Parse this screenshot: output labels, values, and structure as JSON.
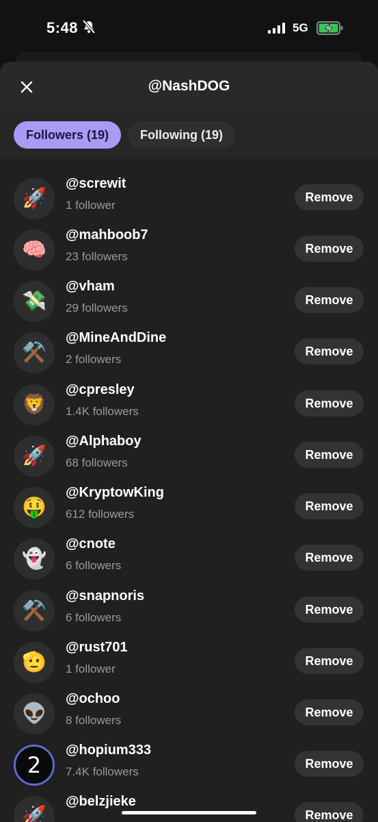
{
  "status_bar": {
    "time": "5:48",
    "network": "5G",
    "bell_icon": "bell-slash-icon",
    "battery_icon": "battery-charging-icon"
  },
  "header": {
    "title": "@NashDOG",
    "close_icon": "close-icon"
  },
  "tabs": [
    {
      "label": "Followers (19)",
      "active": true
    },
    {
      "label": "Following (19)",
      "active": false
    }
  ],
  "accent_color": "#a99bf3",
  "rows": [
    {
      "avatar": "🚀",
      "avatar_icon": "rocket-icon",
      "handle": "@screwit",
      "followers": "1 follower",
      "action": "Remove"
    },
    {
      "avatar": "🧠",
      "avatar_icon": "brain-icon",
      "handle": "@mahboob7",
      "followers": "23 followers",
      "action": "Remove"
    },
    {
      "avatar": "💸",
      "avatar_icon": "money-wings-icon",
      "handle": "@vham",
      "followers": "29 followers",
      "action": "Remove"
    },
    {
      "avatar": "⚒️",
      "avatar_icon": "hammer-pick-icon",
      "handle": "@MineAndDine",
      "followers": "2 followers",
      "action": "Remove"
    },
    {
      "avatar": "🦁",
      "avatar_icon": "lion-icon",
      "handle": "@cpresley",
      "followers": "1.4K followers",
      "action": "Remove"
    },
    {
      "avatar": "🚀",
      "avatar_icon": "rocket-icon",
      "handle": "@Alphaboy",
      "followers": "68 followers",
      "action": "Remove"
    },
    {
      "avatar": "🤑",
      "avatar_icon": "money-mouth-face-icon",
      "handle": "@KryptowKing",
      "followers": "612 followers",
      "action": "Remove"
    },
    {
      "avatar": "👻",
      "avatar_icon": "ghost-icon",
      "handle": "@cnote",
      "followers": "6 followers",
      "action": "Remove"
    },
    {
      "avatar": "⚒️",
      "avatar_icon": "hammer-pick-icon",
      "handle": "@snapnoris",
      "followers": "6 followers",
      "action": "Remove"
    },
    {
      "avatar": "🫡",
      "avatar_icon": "saluting-face-icon",
      "handle": "@rust701",
      "followers": "1 follower",
      "action": "Remove"
    },
    {
      "avatar": "👽",
      "avatar_icon": "alien-icon",
      "handle": "@ochoo",
      "followers": "8 followers",
      "action": "Remove"
    },
    {
      "avatar": "2",
      "avatar_icon": "number-two-ring-icon",
      "handle": "@hopium333",
      "followers": "7.4K followers",
      "action": "Remove"
    },
    {
      "avatar": "🚀",
      "avatar_icon": "rocket-icon",
      "handle": "@belzjieke",
      "followers": "",
      "action": "Remove"
    }
  ]
}
